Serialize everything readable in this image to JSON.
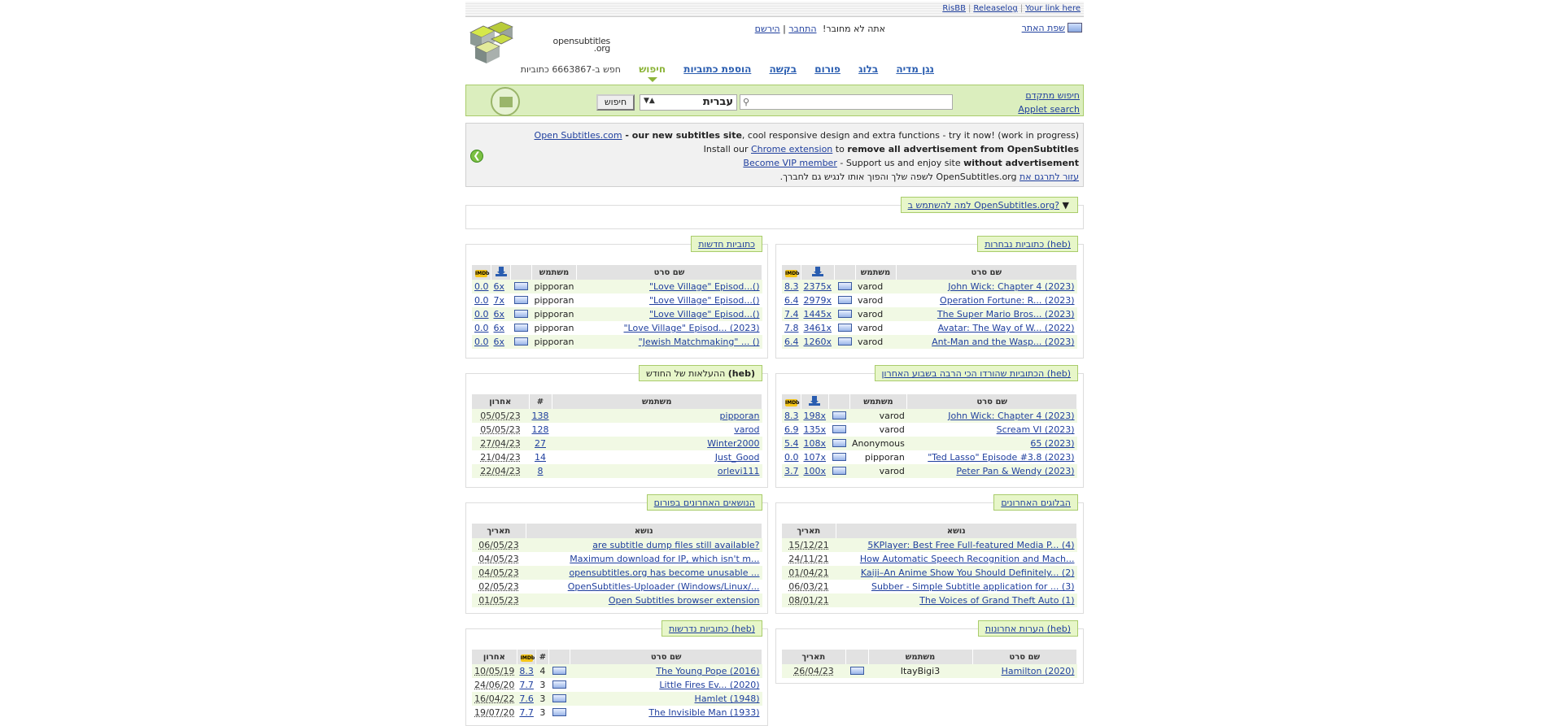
{
  "topbar": {
    "links": [
      "RisBB",
      "Releaselog",
      "Your link here"
    ]
  },
  "logo": {
    "text_line1": "opensubtitles",
    "text_line2": ".org"
  },
  "site_language": {
    "label": "שפת האתר"
  },
  "login": {
    "status": "אתה לא מחובר!",
    "login_link": "התחבר",
    "register_link": "הירשם"
  },
  "nav": {
    "items": [
      "נגן מדיה",
      "בלוג",
      "פורום",
      "בקשה",
      "הוספת כתוביות"
    ],
    "current": "חיפוש",
    "count_text": "חפש ב-6663867 כתוביות"
  },
  "search": {
    "advanced": "חיפוש מתקדם",
    "applet": "Applet search",
    "placeholder": "",
    "language_value": "עברית",
    "button": "חיפוש"
  },
  "notice": {
    "line1_link": "Open Subtitles.com",
    "line1_bold": " - our new subtitles site",
    "line1_rest": ", cool responsive design and extra functions - try it now! (work in progress)",
    "line2_pre": "Install our ",
    "line2_link": "Chrome extension",
    "line2_mid": " to ",
    "line2_bold": "remove all advertisement from OpenSubtitles",
    "line3_link": "Become VIP member",
    "line3_mid": " - Support us and enjoy site ",
    "line3_bold": "without advertisement",
    "line4_link": "עזור לתרגם את",
    "line4_rest": " OpenSubtitles.org לשפה שלך והפוך אותו לנגיש גם לחברך."
  },
  "why": {
    "title": "למה להשתמש ב OpenSubtitles.org?"
  },
  "featured": {
    "title": "כתוביות נבחרות",
    "lang": "(heb)",
    "headers": [
      "שם סרט",
      "משתמש"
    ],
    "rows": [
      {
        "title": "John Wick: Chapter 4 (2023)",
        "user": "varod",
        "dl": "2375x",
        "rating": "8.3"
      },
      {
        "title": "Operation Fortune: R... (2023)",
        "user": "varod",
        "dl": "2979x",
        "rating": "6.4"
      },
      {
        "title": "The Super Mario Bros... (2023)",
        "user": "varod",
        "dl": "1445x",
        "rating": "7.4"
      },
      {
        "title": "Avatar: The Way of W... (2022)",
        "user": "varod",
        "dl": "3461x",
        "rating": "7.8"
      },
      {
        "title": "Ant-Man and the Wasp... (2023)",
        "user": "varod",
        "dl": "1260x",
        "rating": "6.4"
      }
    ]
  },
  "newsubs": {
    "title": "כתוביות חדשות",
    "headers": [
      "שם סרט",
      "משתמש"
    ],
    "rows": [
      {
        "title": "\"Love Village\" Episod...()",
        "user": "pipporan",
        "dl": "6x",
        "rating": "0.0"
      },
      {
        "title": "\"Love Village\" Episod...()",
        "user": "pipporan",
        "dl": "7x",
        "rating": "0.0"
      },
      {
        "title": "\"Love Village\" Episod...()",
        "user": "pipporan",
        "dl": "6x",
        "rating": "0.0"
      },
      {
        "title": "\"Love Village\" Episod... (2023)",
        "user": "pipporan",
        "dl": "6x",
        "rating": "0.0"
      },
      {
        "title": "\"Jewish Matchmaking\" ... ()",
        "user": "pipporan",
        "dl": "6x",
        "rating": "0.0"
      }
    ]
  },
  "mostdl": {
    "title": "הכתוביות שהורדו הכי הרבה בשבוע האחרון",
    "lang": "(heb)",
    "headers": [
      "שם סרט",
      "משתמש"
    ],
    "rows": [
      {
        "title": "John Wick: Chapter 4 (2023)",
        "user": "varod",
        "dl": "198x",
        "rating": "8.3"
      },
      {
        "title": "Scream VI (2023)",
        "user": "varod",
        "dl": "135x",
        "rating": "6.9"
      },
      {
        "title": "65 (2023)",
        "user": "Anonymous",
        "dl": "108x",
        "rating": "5.4"
      },
      {
        "title": "\"Ted Lasso\" Episode #3.8 (2023)",
        "user": "pipporan",
        "dl": "107x",
        "rating": "0.0"
      },
      {
        "title": "Peter Pan & Wendy (2023)",
        "user": "varod",
        "dl": "100x",
        "rating": "3.7"
      }
    ]
  },
  "uploads": {
    "title": "ההעלאות של החודש",
    "lang": "(heb)",
    "headers": [
      "משתמש",
      "#",
      "אחרון"
    ],
    "rows": [
      {
        "user": "pipporan",
        "count": "138",
        "date": "05/05/23"
      },
      {
        "user": "varod",
        "count": "128",
        "date": "05/05/23"
      },
      {
        "user": "Winter2000",
        "count": "27",
        "date": "27/04/23"
      },
      {
        "user": "Just_Good",
        "count": "14",
        "date": "21/04/23"
      },
      {
        "user": "orlevi111",
        "count": "8",
        "date": "22/04/23"
      }
    ]
  },
  "blogs": {
    "title": "הבלוגים האחרונים",
    "headers": [
      "נושא",
      "תאריך"
    ],
    "rows": [
      {
        "topic": "5KPlayer: Best Free Full-featured Media P... (4)",
        "date": "15/12/21"
      },
      {
        "topic": "How Automatic Speech Recognition and Mach...",
        "date": "24/11/21"
      },
      {
        "topic": "Kaiji–An Anime Show You Should Definitely... (2)",
        "date": "01/04/21"
      },
      {
        "topic": "Subber - Simple Subtitle application for ... (3)",
        "date": "06/03/21"
      },
      {
        "topic": "The Voices of Grand Theft Auto (1)",
        "date": "08/01/21"
      }
    ]
  },
  "forum": {
    "title": "הנושאים האחרונים בפורום",
    "headers": [
      "נושא",
      "תאריך"
    ],
    "rows": [
      {
        "topic": "are subtitle dump files still available?",
        "date": "06/05/23"
      },
      {
        "topic": "Maximum download for IP, which isn't m...",
        "date": "04/05/23"
      },
      {
        "topic": "opensubtitles.org has become unusable ...",
        "date": "04/05/23"
      },
      {
        "topic": "OpenSubtitles-Uploader (Windows/Linux/...",
        "date": "02/05/23"
      },
      {
        "topic": "Open Subtitles browser extension",
        "date": "01/05/23"
      }
    ]
  },
  "comments": {
    "title": "הערות אחרונות",
    "lang": "(heb)",
    "headers": [
      "שם סרט",
      "משתמש",
      "תאריך"
    ],
    "rows": [
      {
        "title": "Hamilton (2020)",
        "user": "ItayBigi3",
        "date": "26/04/23"
      }
    ]
  },
  "requested": {
    "title": "כתוביות נדרשות",
    "lang": "(heb)",
    "headers": [
      "שם סרט",
      "#",
      "אחרון"
    ],
    "rows": [
      {
        "title": "The Young Pope (2016)",
        "rating": "8.3",
        "count": "4",
        "date": "10/05/19"
      },
      {
        "title": "Little Fires Ev... (2020)",
        "rating": "7.7",
        "count": "3",
        "date": "24/06/20"
      },
      {
        "title": "Hamlet (1948)",
        "rating": "7.6",
        "count": "3",
        "date": "16/04/22"
      },
      {
        "title": "The Invisible Man (1933)",
        "rating": "7.7",
        "count": "3",
        "date": "19/07/20"
      }
    ]
  }
}
